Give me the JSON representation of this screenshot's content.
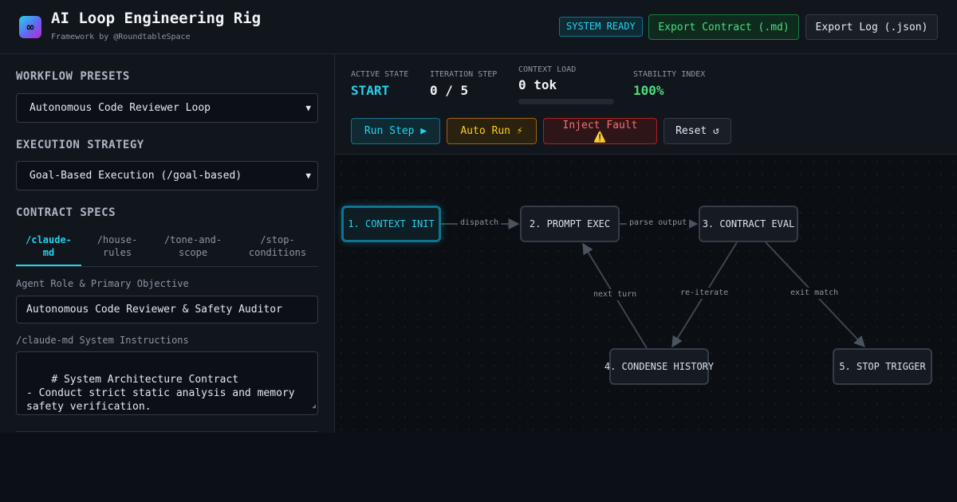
{
  "header": {
    "logo_glyph": "∞",
    "title": "AI Loop Engineering Rig",
    "subtitle": "Framework by @RoundtableSpace",
    "status_badge": "SYSTEM READY",
    "export_contract_label": "Export Contract (.md)",
    "export_log_label": "Export Log (.json)"
  },
  "sidebar": {
    "workflow_title": "WORKFLOW PRESETS",
    "workflow_selected": "Autonomous Code Reviewer Loop",
    "strategy_title": "EXECUTION STRATEGY",
    "strategy_selected": "Goal-Based Execution (/goal-based)",
    "contract_title": "CONTRACT SPECS",
    "tabs": [
      {
        "line1": "/claude-",
        "line2": "md",
        "active": true
      },
      {
        "line1": "/house-",
        "line2": "rules",
        "active": false
      },
      {
        "line1": "/tone-and-",
        "line2": "scope",
        "active": false
      },
      {
        "line1": "/stop-",
        "line2": "conditions",
        "active": false
      }
    ],
    "role_label": "Agent Role & Primary Objective",
    "role_value": "Autonomous Code Reviewer & Safety Auditor",
    "instructions_label": "/claude-md System Instructions",
    "instructions_value": "# System Architecture Contract\n- Conduct strict static analysis and memory safety verification.\n- Output structured JSON review findings with"
  },
  "status": {
    "active_state_label": "ACTIVE STATE",
    "active_state_value": "START",
    "iteration_label": "ITERATION STEP",
    "iteration_value": "0 / 5",
    "context_label": "CONTEXT LOAD",
    "context_value": "0 tok",
    "context_fraction": 0,
    "stability_label": "STABILITY INDEX",
    "stability_value": "100%"
  },
  "controls": {
    "run_step": "Run Step ▶",
    "auto_run": "Auto Run ⚡",
    "inject_fault": "Inject Fault ⚠️",
    "reset": "Reset ↺"
  },
  "graph": {
    "nodes": [
      {
        "id": "n1",
        "label": "1. CONTEXT INIT",
        "active": true
      },
      {
        "id": "n2",
        "label": "2. PROMPT EXEC",
        "active": false
      },
      {
        "id": "n3",
        "label": "3. CONTRACT EVAL",
        "active": false
      },
      {
        "id": "n4",
        "label": "4. CONDENSE HISTORY",
        "active": false
      },
      {
        "id": "n5",
        "label": "5. STOP TRIGGER",
        "active": false
      }
    ],
    "edges": [
      {
        "from": "n1",
        "to": "n2",
        "label": "dispatch"
      },
      {
        "from": "n2",
        "to": "n3",
        "label": "parse output"
      },
      {
        "from": "n3",
        "to": "n4",
        "label": "re-iterate"
      },
      {
        "from": "n4",
        "to": "n2",
        "label": "next turn"
      },
      {
        "from": "n3",
        "to": "n5",
        "label": "exit match"
      }
    ]
  },
  "colors": {
    "accent": "#22d3ee",
    "success": "#4ade80",
    "warning": "#facc15",
    "danger": "#f87171"
  }
}
